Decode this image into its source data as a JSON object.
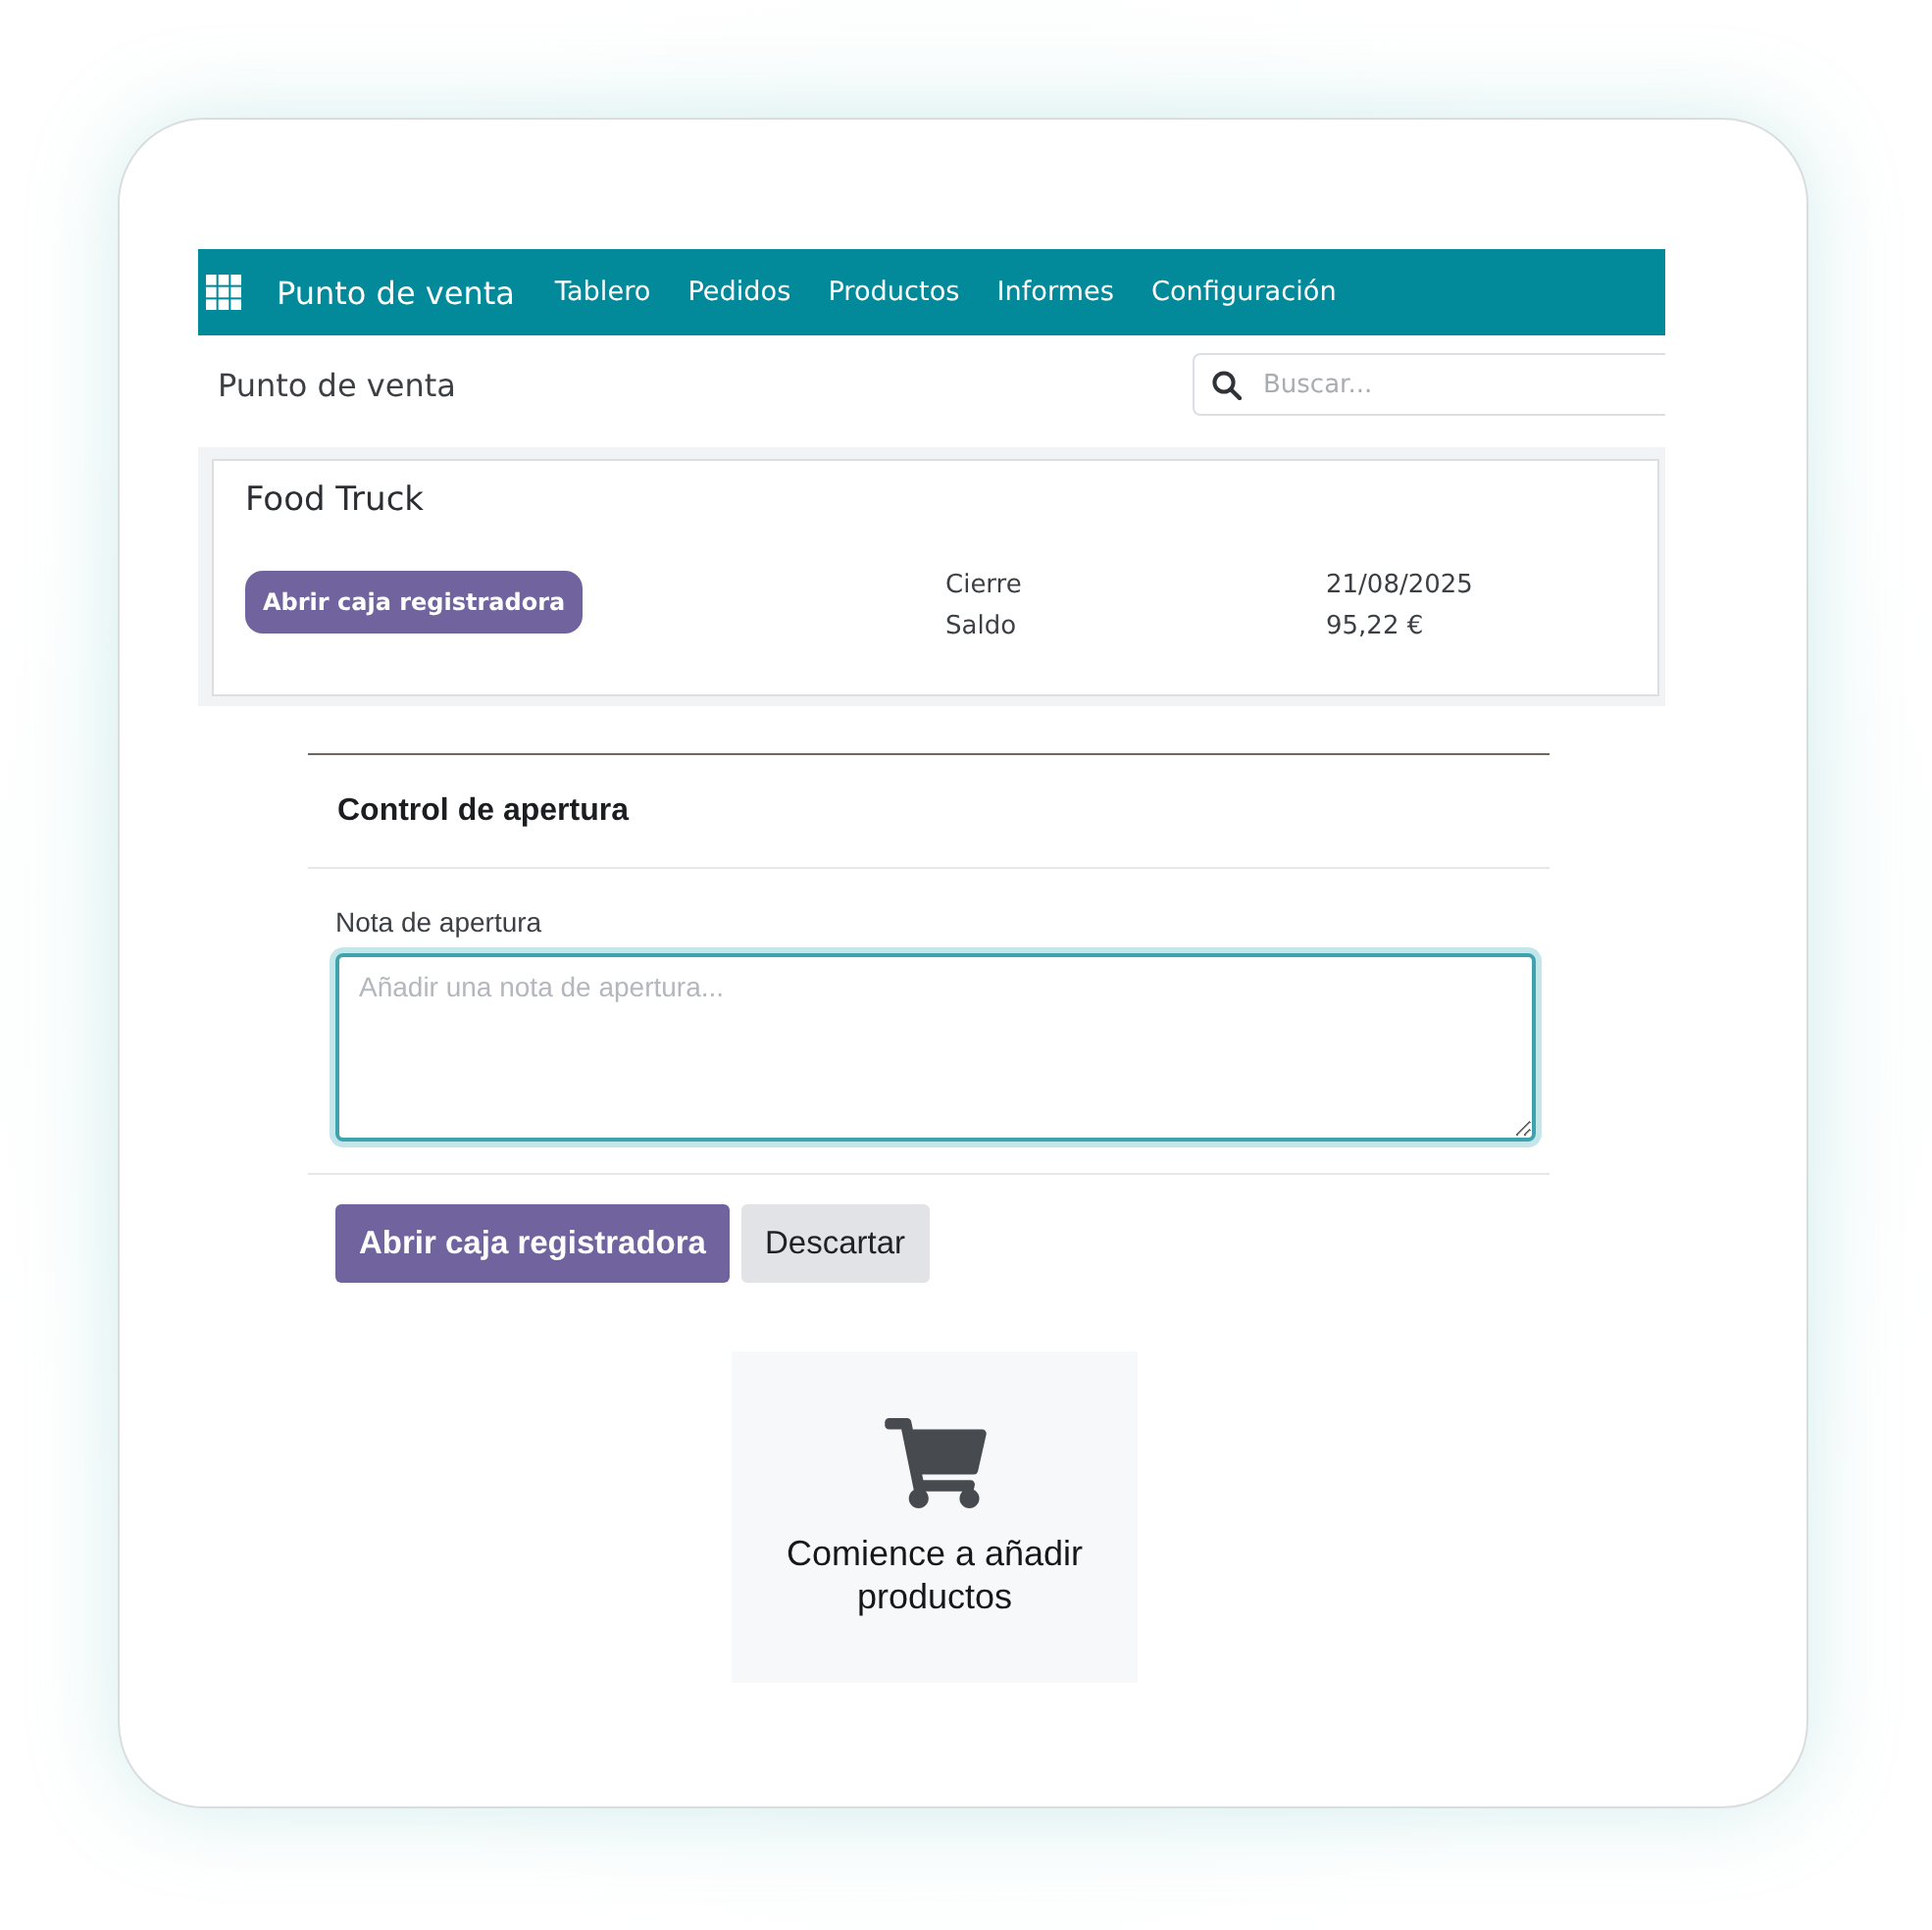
{
  "navbar": {
    "brand": "Punto de venta",
    "menu": [
      "Tablero",
      "Pedidos",
      "Productos",
      "Informes",
      "Configuración"
    ]
  },
  "control_panel": {
    "breadcrumb": "Punto de venta",
    "search": {
      "placeholder": "Buscar..."
    }
  },
  "pos_card": {
    "title": "Food Truck",
    "button": "Abrir caja registradora",
    "details": [
      {
        "label": "Cierre",
        "value": "21/08/2025"
      },
      {
        "label": "Saldo",
        "value": "95,22 €"
      }
    ]
  },
  "dialog": {
    "title": "Control de apertura",
    "note_label": "Nota de apertura",
    "note": {
      "placeholder": "Añadir una nota de apertura...",
      "focused": true
    },
    "buttons": [
      {
        "label": "Abrir caja registradora",
        "kind": "primary"
      },
      {
        "label": "Descartar",
        "kind": "secondary"
      }
    ]
  },
  "empty_state": {
    "message": "Comience a añadir productos"
  }
}
